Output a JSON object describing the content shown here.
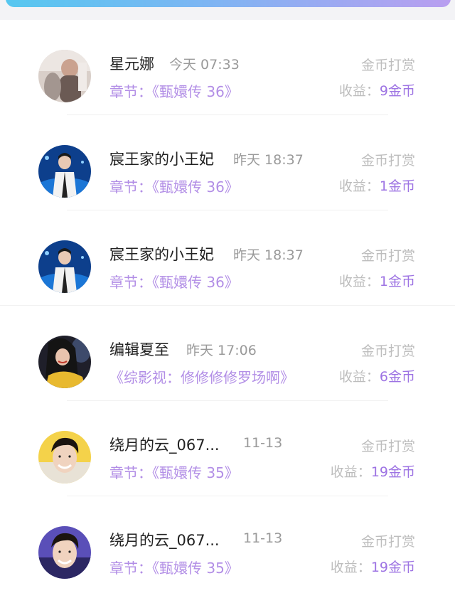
{
  "items": [
    {
      "name": "星元娜",
      "time": "今天 07:33",
      "type": "金币打赏",
      "chapter_prefix": "章节：",
      "chapter": "《甄嬛传 36》",
      "income_label": "收益：",
      "income_value": "9金币",
      "avatar": "avatar-photo-1"
    },
    {
      "name": "宸王家的小王妃",
      "time": "昨天 18:37",
      "type": "金币打赏",
      "chapter_prefix": "章节：",
      "chapter": "《甄嬛传 36》",
      "income_label": "收益：",
      "income_value": "1金币",
      "avatar": "avatar-photo-2"
    },
    {
      "name": "宸王家的小王妃",
      "time": "昨天 18:37",
      "type": "金币打赏",
      "chapter_prefix": "章节：",
      "chapter": "《甄嬛传 36》",
      "income_label": "收益：",
      "income_value": "1金币",
      "avatar": "avatar-photo-2"
    },
    {
      "name": "编辑夏至",
      "time": "昨天 17:06",
      "type": "金币打赏",
      "chapter_prefix": "",
      "chapter": "《综影视：修修修修罗场啊》",
      "income_label": "收益：",
      "income_value": "6金币",
      "avatar": "avatar-photo-3"
    },
    {
      "name": "绕月的云_067...",
      "time": "11-13",
      "type": "金币打赏",
      "chapter_prefix": "章节：",
      "chapter": "《甄嬛传 35》",
      "income_label": "收益：",
      "income_value": "19金币",
      "avatar": "avatar-photo-4"
    },
    {
      "name": "绕月的云_067...",
      "time": "11-13",
      "type": "金币打赏",
      "chapter_prefix": "章节：",
      "chapter": "《甄嬛传 35》",
      "income_label": "收益：",
      "income_value": "19金币",
      "avatar": "avatar-photo-4"
    }
  ],
  "colors": {
    "accent": "#9d73e3",
    "chapter": "#b28ee6",
    "muted": "#bdbdbd",
    "time": "#9a9a9a"
  }
}
